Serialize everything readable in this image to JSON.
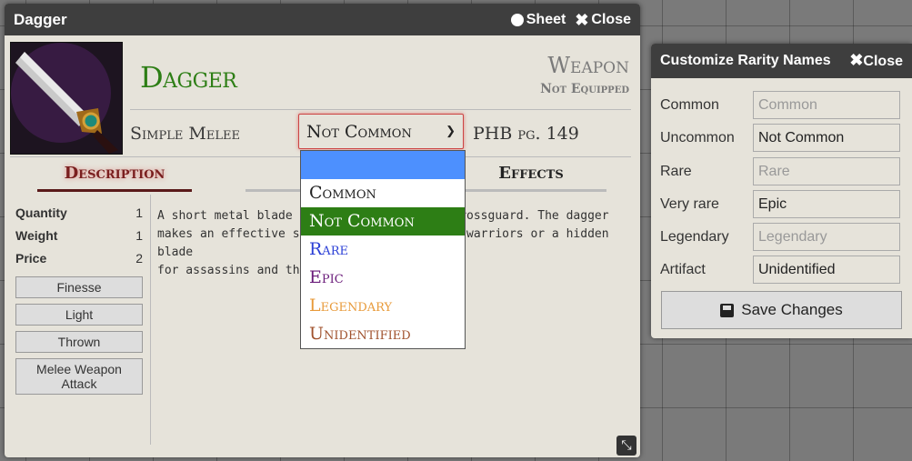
{
  "item_window": {
    "title": "Dagger",
    "sheet_label": "Sheet",
    "close_label": "Close",
    "name": "Dagger",
    "type": "Weapon",
    "equip_status": "Not Equipped",
    "subtype": "Simple Melee",
    "rarity_selected": "Not Common",
    "source": "PHB pg. 149",
    "tabs": {
      "description": "Description",
      "effects": "Effects"
    },
    "props": [
      {
        "label": "Quantity",
        "value": "1"
      },
      {
        "label": "Weight",
        "value": "1"
      },
      {
        "label": "Price",
        "value": "2"
      }
    ],
    "tags": [
      "Finesse",
      "Light",
      "Thrown"
    ],
    "attack_tag": {
      "line1": "Melee Weapon",
      "line2": "Attack"
    },
    "description": {
      "line1": "A short metal blade mo",
      "line1b": "rossguard. The dagger",
      "line2": "makes an effective side",
      "line2b": "warriors or a hidden blade",
      "line3": "for assassins and thieve"
    }
  },
  "dropdown": {
    "options": [
      {
        "label": "",
        "color": "#4d90fe"
      },
      {
        "label": "Common",
        "color": "#222222"
      },
      {
        "label": "Not Common",
        "color": "#ffffff"
      },
      {
        "label": "Rare",
        "color": "#2b3fd6"
      },
      {
        "label": "Epic",
        "color": "#6a1b7a"
      },
      {
        "label": "Legendary",
        "color": "#e89a3a"
      },
      {
        "label": "Unidentified",
        "color": "#a0522d"
      }
    ]
  },
  "rarity_window": {
    "title": "Customize Rarity Names",
    "close_label": "Close",
    "rows": [
      {
        "label": "Common",
        "value": "",
        "placeholder": "Common"
      },
      {
        "label": "Uncommon",
        "value": "Not Common",
        "placeholder": ""
      },
      {
        "label": "Rare",
        "value": "",
        "placeholder": "Rare"
      },
      {
        "label": "Very rare",
        "value": "Epic",
        "placeholder": ""
      },
      {
        "label": "Legendary",
        "value": "",
        "placeholder": "Legendary"
      },
      {
        "label": "Artifact",
        "value": "Unidentified",
        "placeholder": ""
      }
    ],
    "save_label": "Save Changes"
  }
}
